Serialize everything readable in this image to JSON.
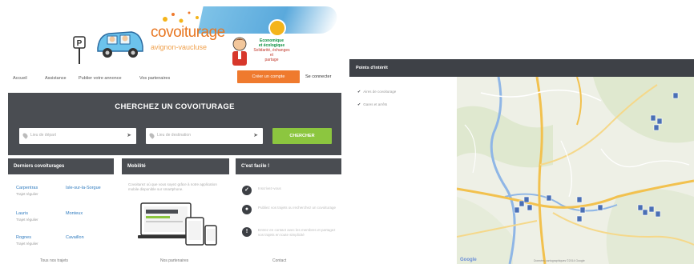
{
  "left_page": {
    "logo": {
      "brand_line1": "covoiturage",
      "brand_line2": "avignon-vaucluse",
      "tagline_1": "Economique",
      "tagline_2": "et écologique",
      "tagline_3": "Solidarité, échanges et",
      "tagline_4": "partage"
    },
    "nav": {
      "items": [
        "Accueil",
        "Assistance",
        "Publier votre annonce",
        "Vos partenaires"
      ],
      "create_account": "Créer un compte",
      "login": "Se connecter"
    },
    "search": {
      "title": "CHERCHEZ UN COVOITURAGE",
      "from_placeholder": "Lieu de départ",
      "to_placeholder": "Lieu de destination",
      "button": "CHERCHER"
    },
    "panels": {
      "rides_title": "Derniers covoiturages",
      "mobility_title": "Mobilité",
      "easy_title": "C'est facile !"
    },
    "rides": [
      {
        "city": "Carpentras",
        "sub": "Trajet régulier"
      },
      {
        "city": "Isle-sur-la-Sorgue",
        "sub": ""
      },
      {
        "city": "Lauris",
        "sub": "Trajet régulier"
      },
      {
        "city": "Monteux",
        "sub": ""
      },
      {
        "city": "Rognes",
        "sub": "Trajet régulier"
      },
      {
        "city": "Cavaillon",
        "sub": ""
      }
    ],
    "mobility_text": "Covoiturez où que vous soyez grâce à notre application mobile disponible sur smartphone.",
    "easy_steps": [
      {
        "icon": "check-icon",
        "text": "Inscrivez-vous"
      },
      {
        "icon": "pin-icon",
        "text": "Publiez vos trajets ou recherchez un covoiturage"
      },
      {
        "icon": "info-icon",
        "text": "Entrez en contact avec les membres et partagez vos trajets en toute simplicité"
      }
    ],
    "footer_links": [
      "Tous nos trajets",
      "Nos partenaires",
      "Contact"
    ],
    "colors": {
      "accent_orange": "#ef7a2e",
      "search_green": "#8cc63f",
      "band_dark": "#4a4d52",
      "link_blue": "#2f7bbf"
    }
  },
  "right_page": {
    "title": "Points d'intérêt",
    "filters": [
      "Aires de covoiturage",
      "Gares et arrêts"
    ],
    "map_attribution": "Google",
    "map_copyright": "Données cartographiques ©2014 Google",
    "colors": {
      "header_dark": "#3e4147",
      "marker_blue": "#4a6fb5"
    }
  }
}
